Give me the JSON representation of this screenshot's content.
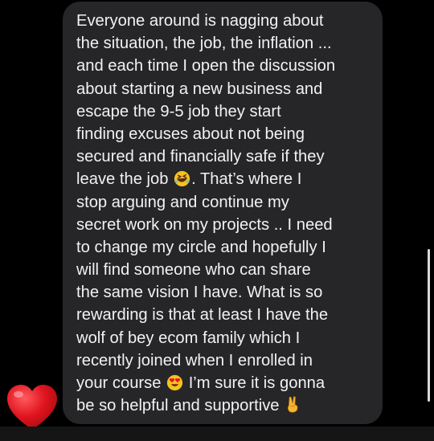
{
  "message": {
    "lines": [
      "Everyone around is nagging about",
      "the situation, the job, the inflation ...",
      "and each time I open the discussion",
      "about starting a new business and",
      "escape the 9-5 job they start",
      "finding excuses about not being",
      "secured and financially safe if they",
      "leave the job",
      ". That’s where I",
      "stop arguing and continue my",
      "secret work on my projects .. I need",
      "to change my circle and hopefully I",
      "will find someone who can share",
      "the same vision I have. What is so",
      "rewarding is that at least I have the",
      "wolf of bey ecom family which I",
      "recently joined when I enrolled in",
      "your course",
      "I’m sure it is gonna",
      "be so helpful and supportive"
    ],
    "emojis": {
      "laugh": "rolling-on-floor-laughing-emoji",
      "love": "heart-eyes-emoji",
      "victory": "victory-hand-emoji"
    }
  },
  "reaction": {
    "icon": "red-heart-icon",
    "color": "#e0141e"
  },
  "colors": {
    "background": "#000000",
    "bubble": "#262628",
    "text": "#f2f2f4"
  }
}
